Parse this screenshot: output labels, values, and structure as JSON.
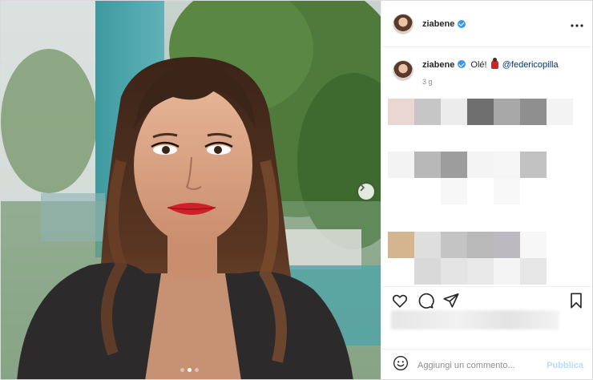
{
  "post": {
    "username": "ziabene",
    "verified": true,
    "caption": {
      "username": "ziabene",
      "text": "Olé!",
      "emoji": "dancer-emoji",
      "mention": "@federicopilla",
      "time": "3 g"
    },
    "carousel": {
      "next_icon": "chevron-right-icon",
      "slide_count": 3,
      "active_slide": 2
    },
    "actions": {
      "like_icon": "heart-icon",
      "comment_icon": "comment-icon",
      "share_icon": "paper-plane-icon",
      "save_icon": "bookmark-icon"
    },
    "more_icon": "more-horizontal-icon",
    "comment_box": {
      "emoji_icon": "smiley-icon",
      "placeholder": "Aggiungi un commento...",
      "publish_label": "Pubblica"
    }
  },
  "colors": {
    "accent": "#3897f0",
    "publish_disabled": "#b2dffc",
    "mention": "#00376b",
    "secondary_text": "#8e8e8e"
  }
}
